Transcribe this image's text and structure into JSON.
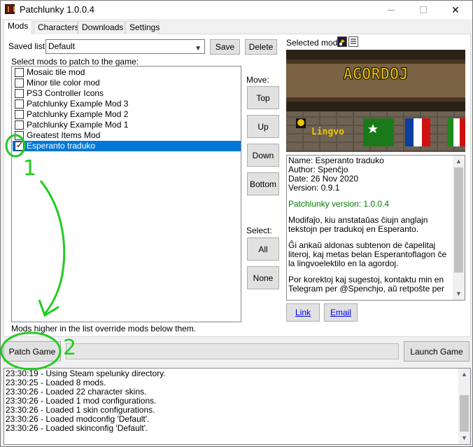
{
  "window": {
    "title": "Patchlunky 1.0.0.4"
  },
  "tabs": [
    "Mods",
    "Characters",
    "Downloads",
    "Settings"
  ],
  "saved_list": {
    "label": "Saved list:",
    "value": "Default",
    "save_label": "Save",
    "delete_label": "Delete"
  },
  "mods": {
    "heading": "Select mods to patch to the game:",
    "items": [
      {
        "label": "Mosaic tile mod",
        "checked": false
      },
      {
        "label": "Minor tile color mod",
        "checked": false
      },
      {
        "label": "PS3 Controller Icons",
        "checked": false
      },
      {
        "label": "Patchlunky Example Mod 3",
        "checked": false
      },
      {
        "label": "Patchlunky Example Mod 2",
        "checked": false
      },
      {
        "label": "Patchlunky Example Mod 1",
        "checked": false
      },
      {
        "label": "Greatest Items Mod",
        "checked": false
      },
      {
        "label": "Esperanto traduko",
        "checked": true,
        "selected": true
      }
    ],
    "footer_note": "Mods higher in the list override mods below them."
  },
  "move": {
    "label": "Move:",
    "top": "Top",
    "up": "Up",
    "down": "Down",
    "bottom": "Bottom"
  },
  "select": {
    "label": "Select:",
    "all": "All",
    "none": "None"
  },
  "selected_mod": {
    "label": "Selected mod:",
    "preview": {
      "title": "AGORDOJ",
      "subtitle": "Lingvo"
    },
    "info": {
      "name": "Name: Esperanto traduko",
      "author": "Author: Spenĉjo",
      "date": "Date: 26 Nov 2020",
      "version": "Version: 0.9.1",
      "patchlunky_version": "Patchlunky version: 1.0.0.4",
      "desc1": "Modifaĵo, kiu anstataŭas ĉiujn anglajn tekstojn per tradukoj en Esperanto.",
      "desc2": "Ĝi ankaŭ aldonas subtenon de ĉapelitaj literoj, kaj metas belan Esperantoflagon ĉe la lingvoelektilo en la agordoj.",
      "desc3": "Por korektoj kaj sugestoj, kontaktu min en Telegram per @Spenchjo, aŭ retpoŝte per"
    },
    "link_label": "Link",
    "email_label": "Email"
  },
  "actions": {
    "patch_game": "Patch Game",
    "launch_game": "Launch Game"
  },
  "log": [
    "23:30:19 - Using Steam spelunky directory.",
    "23:30:25 - Loaded 8 mods.",
    "23:30:26 - Loaded 22 character skins.",
    "23:30:26 - Loaded 1 mod configurations.",
    "23:30:26 - Loaded 1 skin configurations.",
    "23:30:26 - Loaded modconfig 'Default'.",
    "23:30:26 - Loaded skinconfig 'Default'."
  ],
  "annotations": {
    "step1": "1",
    "step2": "2",
    "color": "#22cc22"
  },
  "colors": {
    "selection": "#0078d7",
    "link": "#0000ee",
    "version_text": "#008000"
  }
}
